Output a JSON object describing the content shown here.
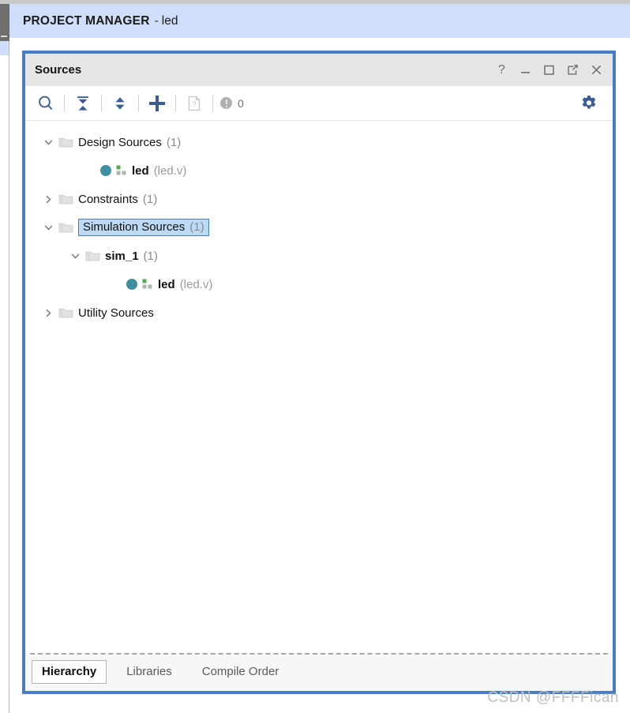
{
  "window": {
    "header_title": "PROJECT MANAGER",
    "header_separator": "-",
    "header_project": "led"
  },
  "panel": {
    "title": "Sources",
    "window_buttons": [
      {
        "name": "help-icon",
        "label": "?"
      },
      {
        "name": "minimize-icon",
        "label": "—"
      },
      {
        "name": "maximize-icon",
        "label": "□"
      },
      {
        "name": "float-icon",
        "label": "↗"
      },
      {
        "name": "close-icon",
        "label": "✕"
      }
    ]
  },
  "toolbar": {
    "buttons": [
      {
        "name": "search-icon",
        "tooltip": "Search"
      },
      {
        "name": "collapse-all-icon",
        "tooltip": "Collapse All"
      },
      {
        "name": "expand-all-icon",
        "tooltip": "Expand All"
      },
      {
        "name": "add-sources-icon",
        "tooltip": "Add Sources"
      },
      {
        "name": "report-icon",
        "tooltip": "Report"
      },
      {
        "name": "settings-gear-icon",
        "tooltip": "Settings"
      }
    ],
    "message_count": "0"
  },
  "tree": {
    "nodes": [
      {
        "id": "design-sources",
        "label": "Design Sources",
        "count": "(1)",
        "indent": 0,
        "twisty": "expanded",
        "icon": "folder-icon",
        "selected": false,
        "bold": false
      },
      {
        "id": "design-sources-led",
        "label": "led",
        "file": "(led.v)",
        "indent": 1,
        "twisty": "none",
        "icon": "module-icon",
        "selected": false,
        "bold": true
      },
      {
        "id": "constraints",
        "label": "Constraints",
        "count": "(1)",
        "indent": 0,
        "twisty": "collapsed",
        "icon": "folder-icon",
        "selected": false,
        "bold": false
      },
      {
        "id": "simulation-sources",
        "label": "Simulation Sources",
        "count": "(1)",
        "indent": 0,
        "twisty": "expanded",
        "icon": "folder-icon",
        "selected": true,
        "bold": false
      },
      {
        "id": "sim-1",
        "label": "sim_1",
        "count": "(1)",
        "indent": 1,
        "twisty": "expanded",
        "icon": "folder-icon",
        "selected": false,
        "bold": true
      },
      {
        "id": "sim-1-led",
        "label": "led",
        "file": "(led.v)",
        "indent": 2,
        "twisty": "none",
        "icon": "module-icon",
        "selected": false,
        "bold": true
      },
      {
        "id": "utility-sources",
        "label": "Utility Sources",
        "count": "",
        "indent": 0,
        "twisty": "collapsed",
        "icon": "folder-icon",
        "selected": false,
        "bold": false
      }
    ]
  },
  "tabs": [
    {
      "id": "hierarchy",
      "label": "Hierarchy",
      "active": true
    },
    {
      "id": "libraries",
      "label": "Libraries",
      "active": false
    },
    {
      "id": "compile-order",
      "label": "Compile Order",
      "active": false
    }
  ],
  "watermark": "CSDN @FFFFican",
  "colors": {
    "accent_blue": "#4a7ec4",
    "header_blue": "#cfdefa",
    "selection_blue": "#bcd9f5",
    "toolbar_icon": "#3a5e94",
    "module_teal": "#3f8fa3",
    "module_green": "#5aa85a"
  }
}
